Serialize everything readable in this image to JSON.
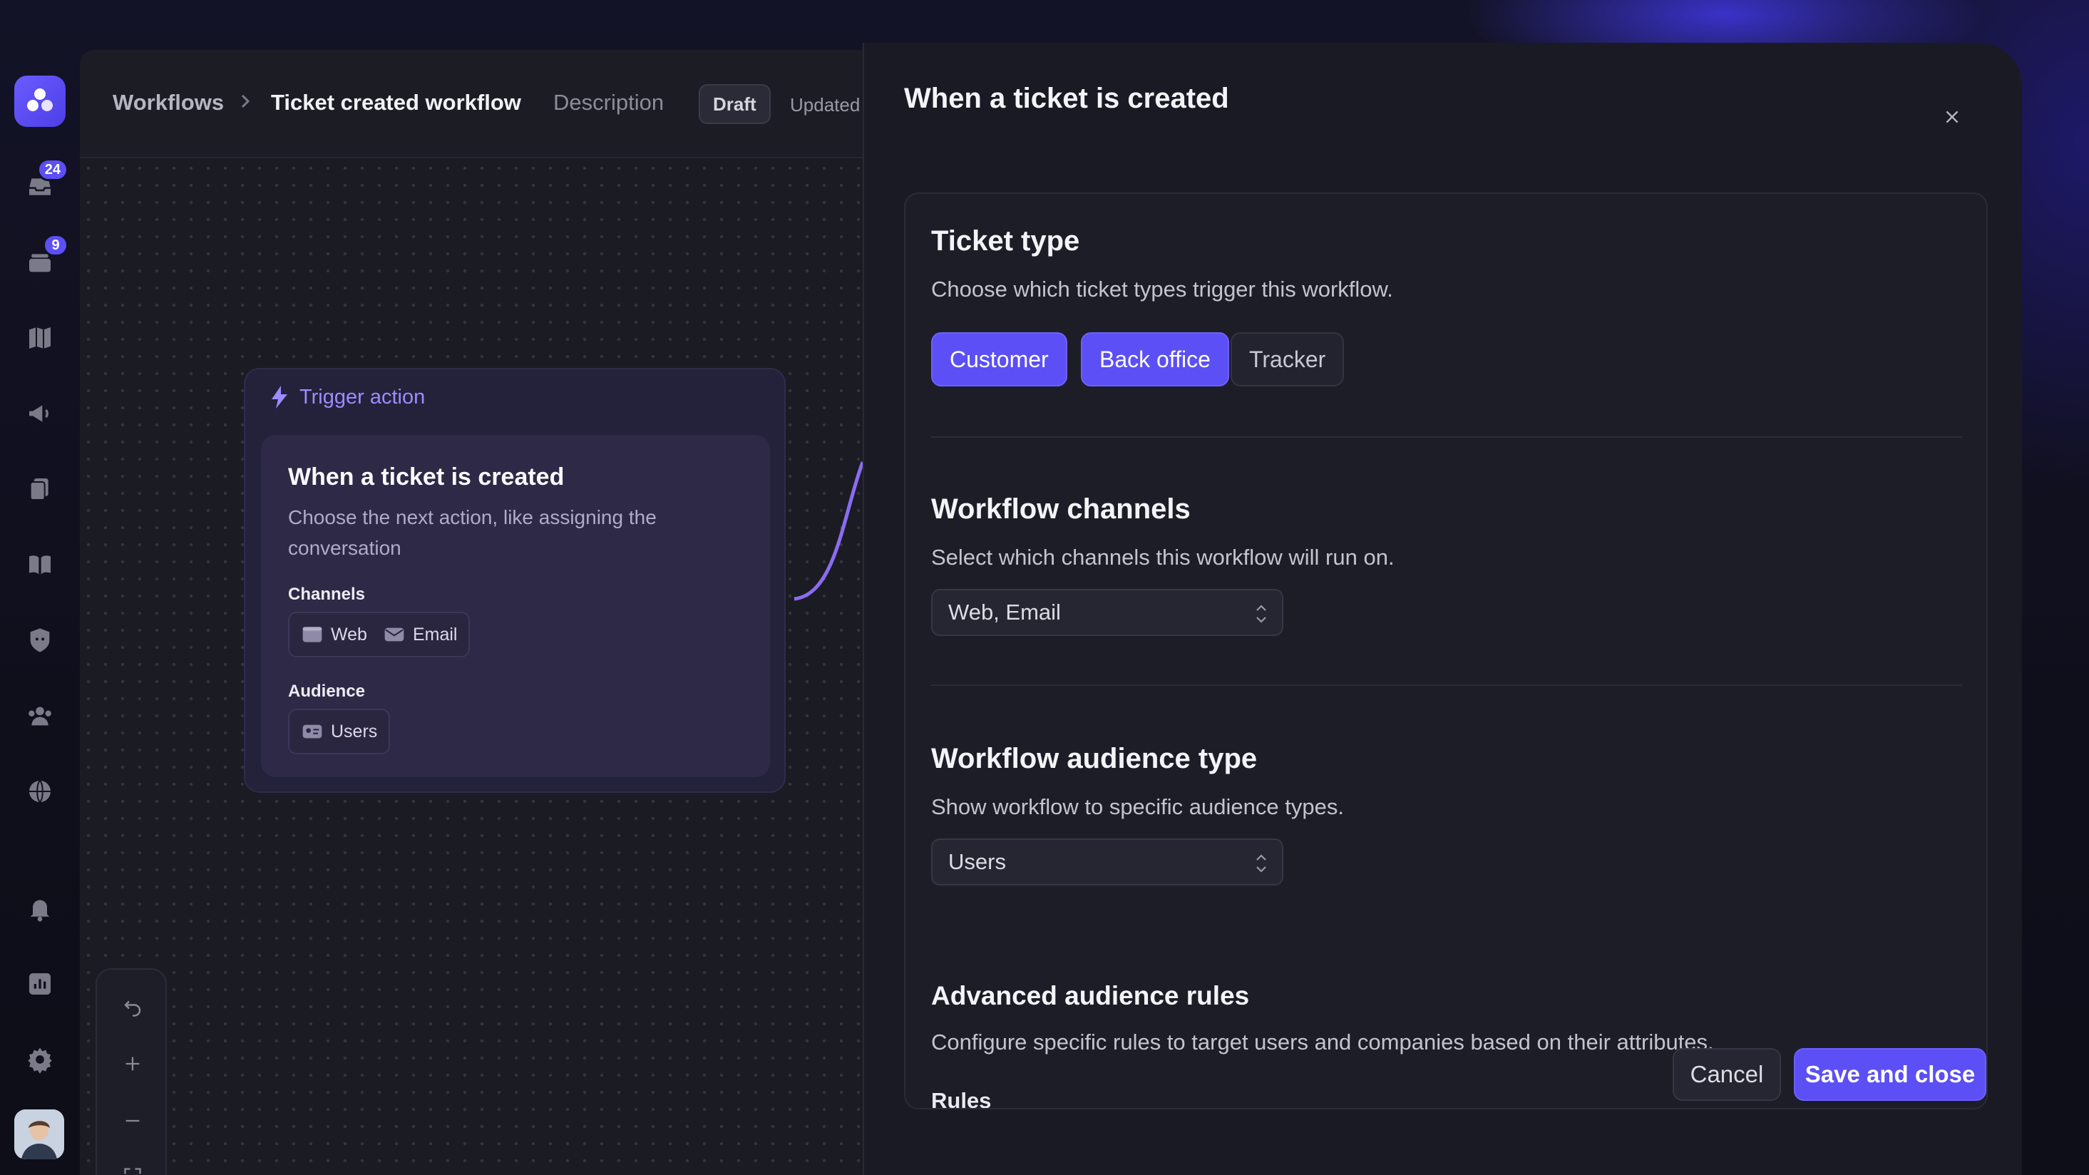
{
  "sidebar": {
    "inbox_badge": "24",
    "tickets_badge": "9",
    "icons": [
      "logo-icon",
      "inbox-icon",
      "tickets-icon",
      "map-icon",
      "megaphone-icon",
      "documents-icon",
      "book-icon",
      "shield-icon",
      "team-icon",
      "globe-icon",
      "bell-icon",
      "chart-icon",
      "gear-icon"
    ]
  },
  "header": {
    "breadcrumb_root": "Workflows",
    "breadcrumb_current": "Ticket created workflow",
    "description_label": "Description",
    "status_badge": "Draft",
    "updated_text": "Updated"
  },
  "node": {
    "header_label": "Trigger action",
    "title": "When a ticket is created",
    "description": "Choose the next action, like assigning the conversation",
    "channels_label": "Channels",
    "channels": [
      "Web",
      "Email"
    ],
    "audience_label": "Audience",
    "audience": [
      "Users"
    ]
  },
  "panel": {
    "title": "When a ticket is created",
    "ticket_type": {
      "title": "Ticket type",
      "description": "Choose which ticket types trigger this workflow.",
      "options": [
        {
          "label": "Customer",
          "selected": true
        },
        {
          "label": "Back office",
          "selected": true
        },
        {
          "label": "Tracker",
          "selected": false
        }
      ]
    },
    "channels": {
      "title": "Workflow channels",
      "description": "Select which channels this workflow will run on.",
      "value": "Web, Email"
    },
    "audience_type": {
      "title": "Workflow audience type",
      "description": "Show workflow to specific audience types.",
      "value": "Users"
    },
    "advanced": {
      "title": "Advanced audience rules",
      "description": "Configure specific rules to target users and companies based on their attributes.",
      "rules_label": "Rules"
    },
    "footer": {
      "cancel_label": "Cancel",
      "save_label": "Save and close"
    }
  },
  "colors": {
    "accent": "#5b4ff5",
    "node_accent": "#9d8cff",
    "background": "#1a1a24"
  }
}
